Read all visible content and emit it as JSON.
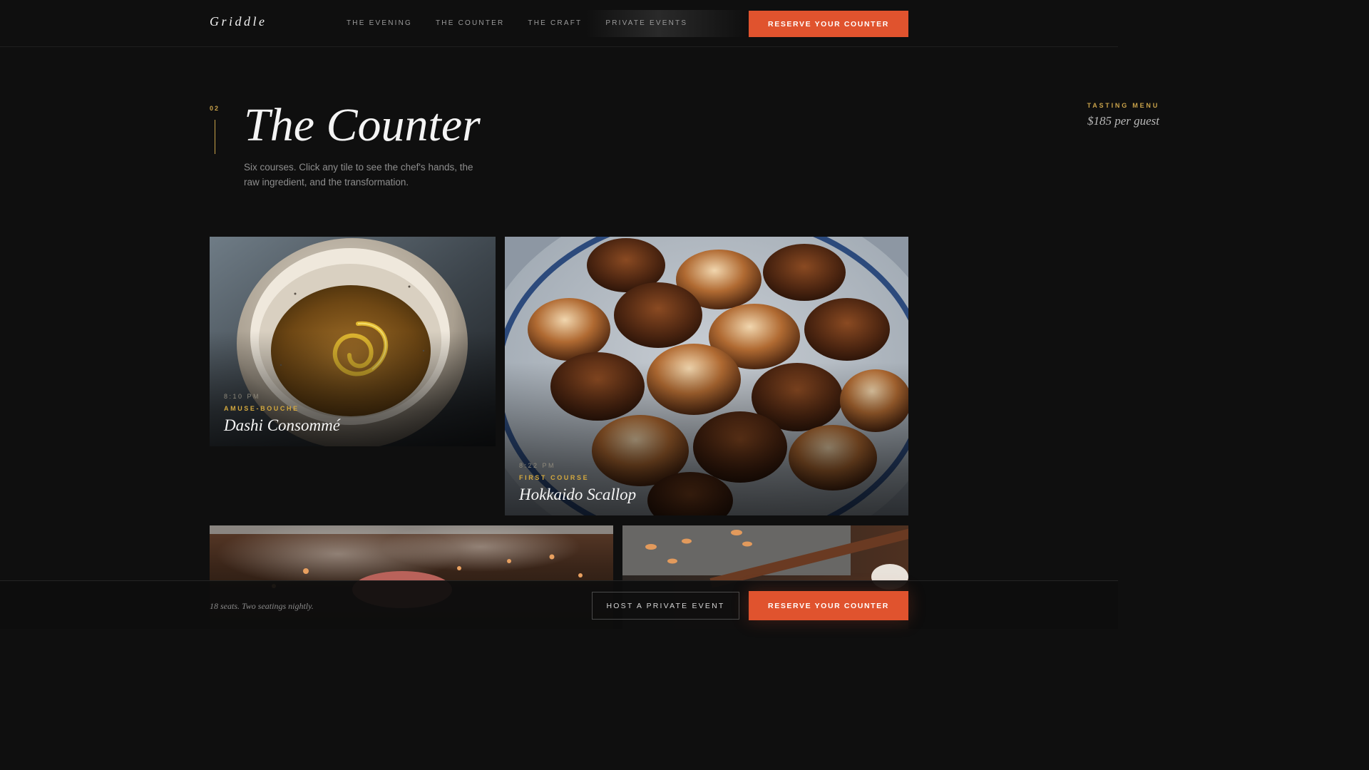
{
  "nav": {
    "brand": "Griddle",
    "links": [
      "THE EVENING",
      "THE COUNTER",
      "THE CRAFT",
      "PRIVATE EVENTS"
    ],
    "reserve_label": "RESERVE YOUR COUNTER"
  },
  "hero": {
    "section_number": "02",
    "title": "The Counter",
    "subtitle": "Six courses. Click any tile to see the chef's hands, the raw ingredient, and the transformation.",
    "menu_label": "TASTING MENU",
    "menu_price": "$185 per guest"
  },
  "tiles": [
    {
      "time": "8:10 PM",
      "course": "AMUSE-BOUCHE",
      "dish": "Dashi Consommé",
      "image": "dashi-bowl-photo"
    },
    {
      "time": "8:22 PM",
      "course": "FIRST COURSE",
      "dish": "Hokkaido Scallop",
      "image": "seared-scallops-photo"
    },
    {
      "image": "teppan-grill-photo"
    },
    {
      "image": "griddle-spatula-photo"
    }
  ],
  "bottom": {
    "seats_text": "18 seats. Two seatings nightly.",
    "private_label": "HOST A PRIVATE EVENT",
    "reserve_label": "RESERVE YOUR COUNTER"
  },
  "colors": {
    "accent": "#e0532e",
    "gold": "#c9a24a",
    "background": "#0f0f0f"
  }
}
